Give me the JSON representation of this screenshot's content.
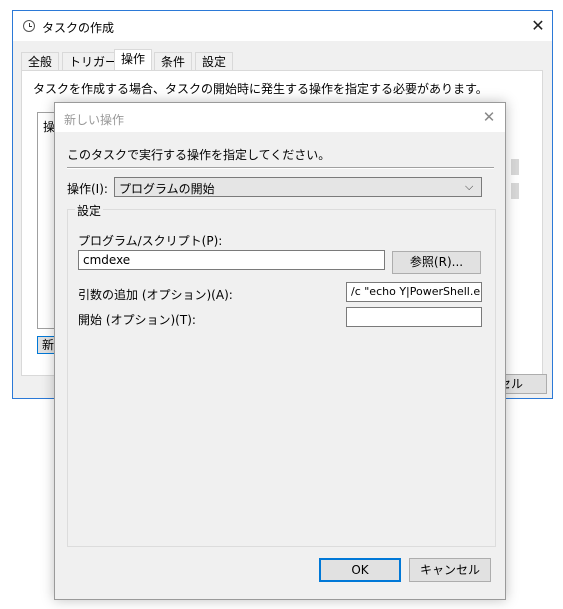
{
  "background_window": {
    "title": "タスクの作成",
    "tabs": [
      {
        "label": "全般"
      },
      {
        "label": "トリガー"
      },
      {
        "label": "操作",
        "active": true
      },
      {
        "label": "条件"
      },
      {
        "label": "設定"
      }
    ],
    "description": "タスクを作成する場合、タスクの開始時に発生する操作を指定する必要があります。",
    "list_header_partial": "操",
    "new_button_partial": "新",
    "cancel_button_partial": "セル"
  },
  "dialog": {
    "title": "新しい操作",
    "instruction": "このタスクで実行する操作を指定してください。",
    "action_label": "操作(I):",
    "action_value": "プログラムの開始",
    "settings_legend": "設定",
    "program_label": "プログラム/スクリプト(P):",
    "program_value": "cmdexe",
    "browse_label": "参照(R)...",
    "args_label": "引数の追加 (オプション)(A):",
    "args_value": "/c \"echo Y|PowerShell.e:",
    "start_label": "開始 (オプション)(T):",
    "start_value": "",
    "ok_label": "OK",
    "cancel_label": "キャンセル"
  },
  "icons": {
    "window_icon": "clock-icon",
    "close": "close-icon",
    "dropdown": "chevron-down-icon"
  },
  "colors": {
    "accent": "#0078d7",
    "window_border": "#2b79d7",
    "dialog_bg": "#f0f0f0"
  }
}
